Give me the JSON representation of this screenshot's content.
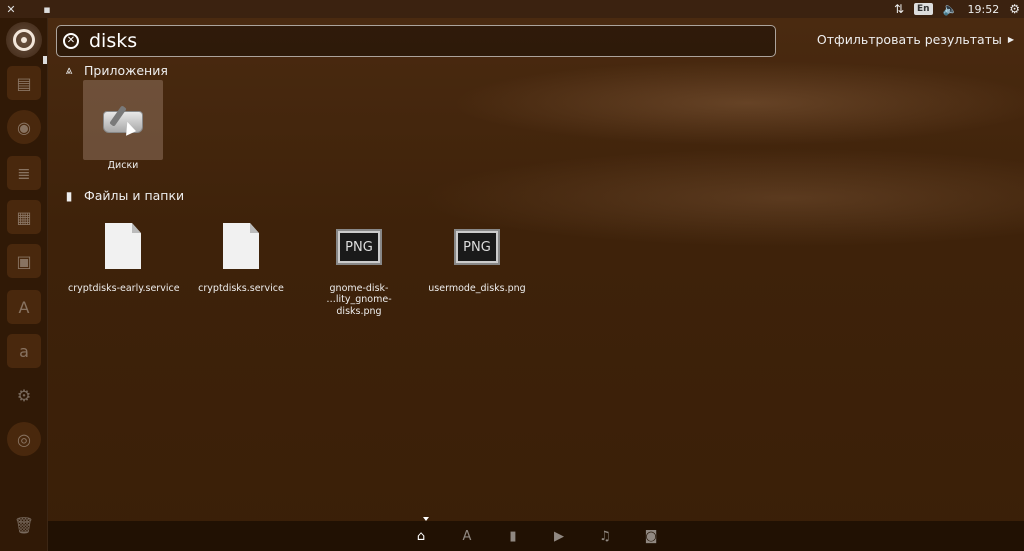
{
  "top_panel": {
    "close_icon": "close-icon",
    "maximize_icon": "maximize-icon",
    "network_icon": "network-arrows-icon",
    "keyboard_layout": "En",
    "volume_icon": "volume-icon",
    "clock": "19:52",
    "settings_icon": "gear-icon"
  },
  "search": {
    "query": "disks",
    "clear_icon": "clear-icon"
  },
  "filter": {
    "label": "Отфильтровать результаты"
  },
  "sections": {
    "apps": {
      "title": "Приложения",
      "icon": "apps-icon"
    },
    "files": {
      "title": "Файлы и папки",
      "icon": "file-icon"
    }
  },
  "apps": [
    {
      "label": "Диски",
      "icon": "disks-icon"
    }
  ],
  "files": [
    {
      "label": "cryptdisks-early.service",
      "type": "doc"
    },
    {
      "label": "cryptdisks.service",
      "type": "doc"
    },
    {
      "label": "gnome-disk-\n…lity_gnome-disks.png",
      "type": "png"
    },
    {
      "label": "usermode_disks.png",
      "type": "png"
    }
  ],
  "png_label": "PNG",
  "launcher": [
    {
      "icon": "ubuntu-logo-icon"
    },
    {
      "icon": "files-icon"
    },
    {
      "icon": "firefox-icon"
    },
    {
      "icon": "writer-icon"
    },
    {
      "icon": "calc-icon"
    },
    {
      "icon": "impress-icon"
    },
    {
      "icon": "software-center-icon"
    },
    {
      "icon": "amazon-icon"
    },
    {
      "icon": "settings-icon"
    },
    {
      "icon": "disc-icon"
    },
    {
      "icon": "trash-icon"
    }
  ],
  "lenses": [
    {
      "icon": "home-icon",
      "active": true
    },
    {
      "icon": "apps-lens-icon"
    },
    {
      "icon": "files-lens-icon"
    },
    {
      "icon": "video-lens-icon"
    },
    {
      "icon": "music-lens-icon"
    },
    {
      "icon": "photo-lens-icon"
    }
  ]
}
